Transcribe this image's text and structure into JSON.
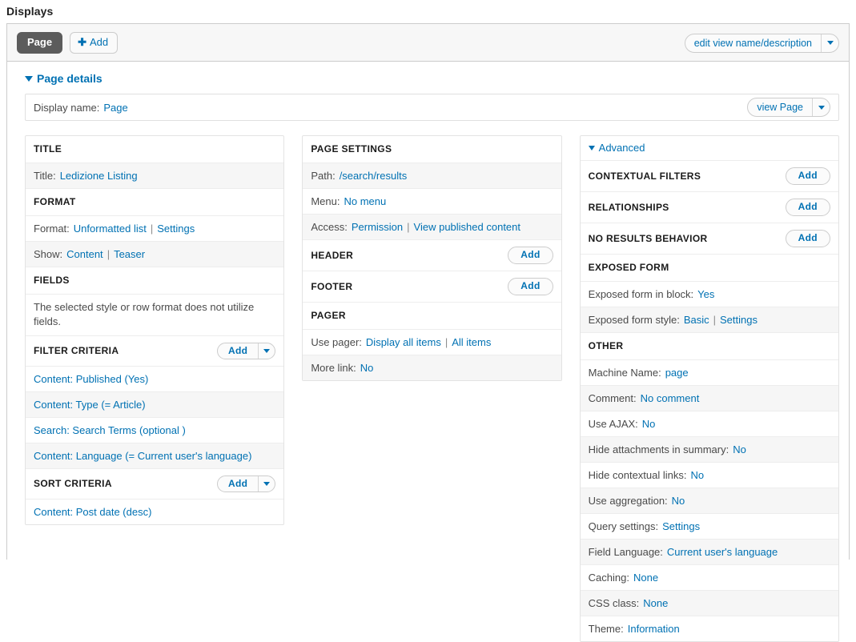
{
  "page_title": "Displays",
  "tabs": {
    "page_tab": "Page",
    "add_tab": "Add",
    "add_icon": "plus-icon",
    "edit_view_button": "edit view name/description",
    "dropdown_icon": "chevron-down-icon"
  },
  "details": {
    "heading": "Page details",
    "collapse_icon": "triangle-down-icon",
    "display_name_label": "Display name:",
    "display_name_value": "Page",
    "view_page_button": "view Page"
  },
  "left_column": {
    "title_section": {
      "header": "TITLE",
      "title_label": "Title:",
      "title_value": "Ledizione Listing"
    },
    "format_section": {
      "header": "FORMAT",
      "format_label": "Format:",
      "format_value": "Unformatted list",
      "format_settings": "Settings",
      "show_label": "Show:",
      "show_value": "Content",
      "show_settings": "Teaser"
    },
    "fields_section": {
      "header": "FIELDS",
      "note": "The selected style or row format does not utilize fields."
    },
    "filter_criteria": {
      "header": "FILTER CRITERIA",
      "add_label": "Add",
      "items": [
        "Content: Published (Yes)",
        "Content: Type (= Article)",
        "Search: Search Terms (optional )",
        "Content: Language (= Current user's language)"
      ]
    },
    "sort_criteria": {
      "header": "SORT CRITERIA",
      "add_label": "Add",
      "items": [
        "Content: Post date (desc)"
      ]
    }
  },
  "middle_column": {
    "page_settings": {
      "header": "PAGE SETTINGS",
      "path_label": "Path:",
      "path_value": "/search/results",
      "menu_label": "Menu:",
      "menu_value": "No menu",
      "access_label": "Access:",
      "access_value": "Permission",
      "access_detail": "View published content"
    },
    "header_section": {
      "header": "HEADER",
      "add_label": "Add"
    },
    "footer_section": {
      "header": "FOOTER",
      "add_label": "Add"
    },
    "pager_section": {
      "header": "PAGER",
      "use_pager_label": "Use pager:",
      "use_pager_value": "Display all items",
      "use_pager_detail": "All items",
      "more_link_label": "More link:",
      "more_link_value": "No"
    }
  },
  "right_column": {
    "advanced_heading": "Advanced",
    "contextual_filters": {
      "header": "CONTEXTUAL FILTERS",
      "add_label": "Add"
    },
    "relationships": {
      "header": "RELATIONSHIPS",
      "add_label": "Add"
    },
    "no_results_behavior": {
      "header": "NO RESULTS BEHAVIOR",
      "add_label": "Add"
    },
    "exposed_form": {
      "header": "EXPOSED FORM",
      "in_block_label": "Exposed form in block:",
      "in_block_value": "Yes",
      "style_label": "Exposed form style:",
      "style_value": "Basic",
      "style_settings": "Settings"
    },
    "other": {
      "header": "OTHER",
      "rows": [
        {
          "label": "Machine Name:",
          "value": "page"
        },
        {
          "label": "Comment:",
          "value": "No comment"
        },
        {
          "label": "Use AJAX:",
          "value": "No"
        },
        {
          "label": "Hide attachments in summary:",
          "value": "No"
        },
        {
          "label": "Hide contextual links:",
          "value": "No"
        },
        {
          "label": "Use aggregation:",
          "value": "No"
        },
        {
          "label": "Query settings:",
          "value": "Settings"
        },
        {
          "label": "Field Language:",
          "value": "Current user's language"
        },
        {
          "label": "Caching:",
          "value": "None"
        },
        {
          "label": "CSS class:",
          "value": "None"
        },
        {
          "label": "Theme:",
          "value": "Information"
        }
      ]
    }
  },
  "colors": {
    "link": "#0071b3",
    "active_tab_bg": "#5c5c5c",
    "row_alt_bg": "#f6f6f6",
    "panel_border": "#e3e3e3"
  }
}
